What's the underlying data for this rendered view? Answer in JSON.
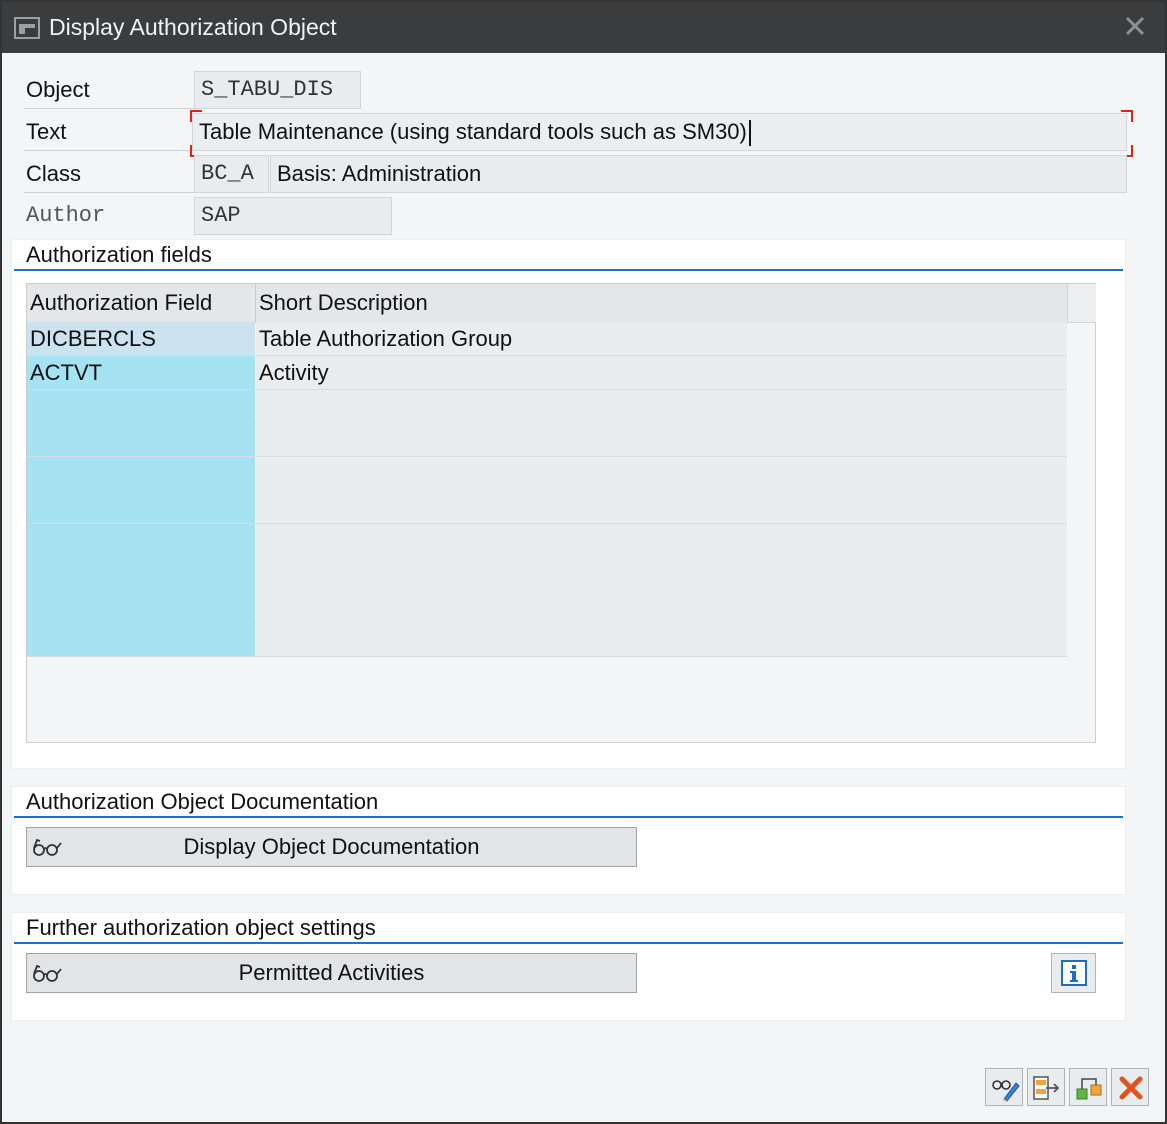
{
  "window": {
    "title": "Display Authorization Object"
  },
  "header": {
    "object_label": "Object",
    "object_value": "S_TABU_DIS",
    "text_label": "Text",
    "text_value": "Table Maintenance (using standard tools such as SM30)",
    "class_label": "Class",
    "class_code": "BC_A",
    "class_desc": "Basis: Administration",
    "author_label": "Author",
    "author_value": "SAP"
  },
  "fields_section": {
    "title": "Authorization fields",
    "columns": [
      "Authorization Field",
      "Short Description"
    ],
    "rows": [
      {
        "field": "DICBERCLS",
        "description": "Table Authorization Group"
      },
      {
        "field": "ACTVT",
        "description": "Activity"
      },
      {
        "field": "",
        "description": ""
      },
      {
        "field": "",
        "description": ""
      },
      {
        "field": "",
        "description": ""
      },
      {
        "field": "",
        "description": ""
      },
      {
        "field": "",
        "description": ""
      },
      {
        "field": "",
        "description": ""
      },
      {
        "field": "",
        "description": ""
      },
      {
        "field": "",
        "description": ""
      }
    ]
  },
  "documentation_section": {
    "title": "Authorization Object Documentation",
    "button_label": "Display Object Documentation",
    "button_icon": "glasses-icon"
  },
  "settings_section": {
    "title": "Further authorization object settings",
    "button_label": "Permitted Activities",
    "button_icon": "glasses-icon",
    "info_icon": "info-icon"
  },
  "footer_buttons": [
    "display-change-icon",
    "transport-icon",
    "hierarchy-icon",
    "cancel-icon"
  ],
  "colors": {
    "accent": "#1a73c8",
    "titlebar": "#3a3c3e",
    "highlight": "#a5e3f2",
    "required": "#d9261c"
  }
}
